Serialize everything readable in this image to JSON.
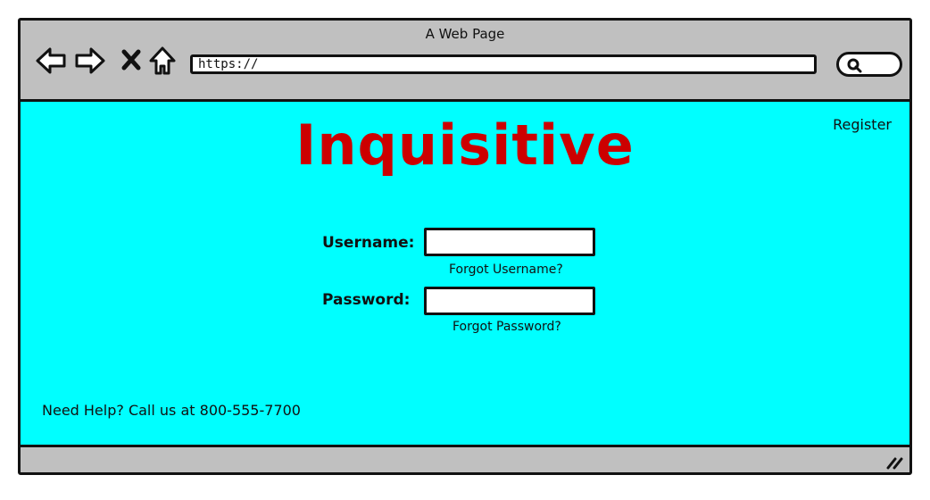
{
  "window": {
    "title": "A Web Page"
  },
  "toolbar": {
    "back_icon": "back-arrow-icon",
    "forward_icon": "forward-arrow-icon",
    "stop_icon": "close-icon",
    "home_icon": "home-icon",
    "url": "https://",
    "search_icon": "search-icon"
  },
  "header": {
    "register_label": "Register",
    "logo_text": "Inquisitive",
    "logo_color": "#cc0000"
  },
  "form": {
    "username_label": "Username:",
    "username_value": "",
    "forgot_username": "Forgot Username?",
    "password_label": "Password:",
    "password_value": "",
    "forgot_password": "Forgot Password?"
  },
  "footer": {
    "help_text": "Need Help? Call us at 800-555-7700"
  },
  "colors": {
    "content_bg": "#00ffff",
    "chrome_bg": "#c0c0c0"
  }
}
